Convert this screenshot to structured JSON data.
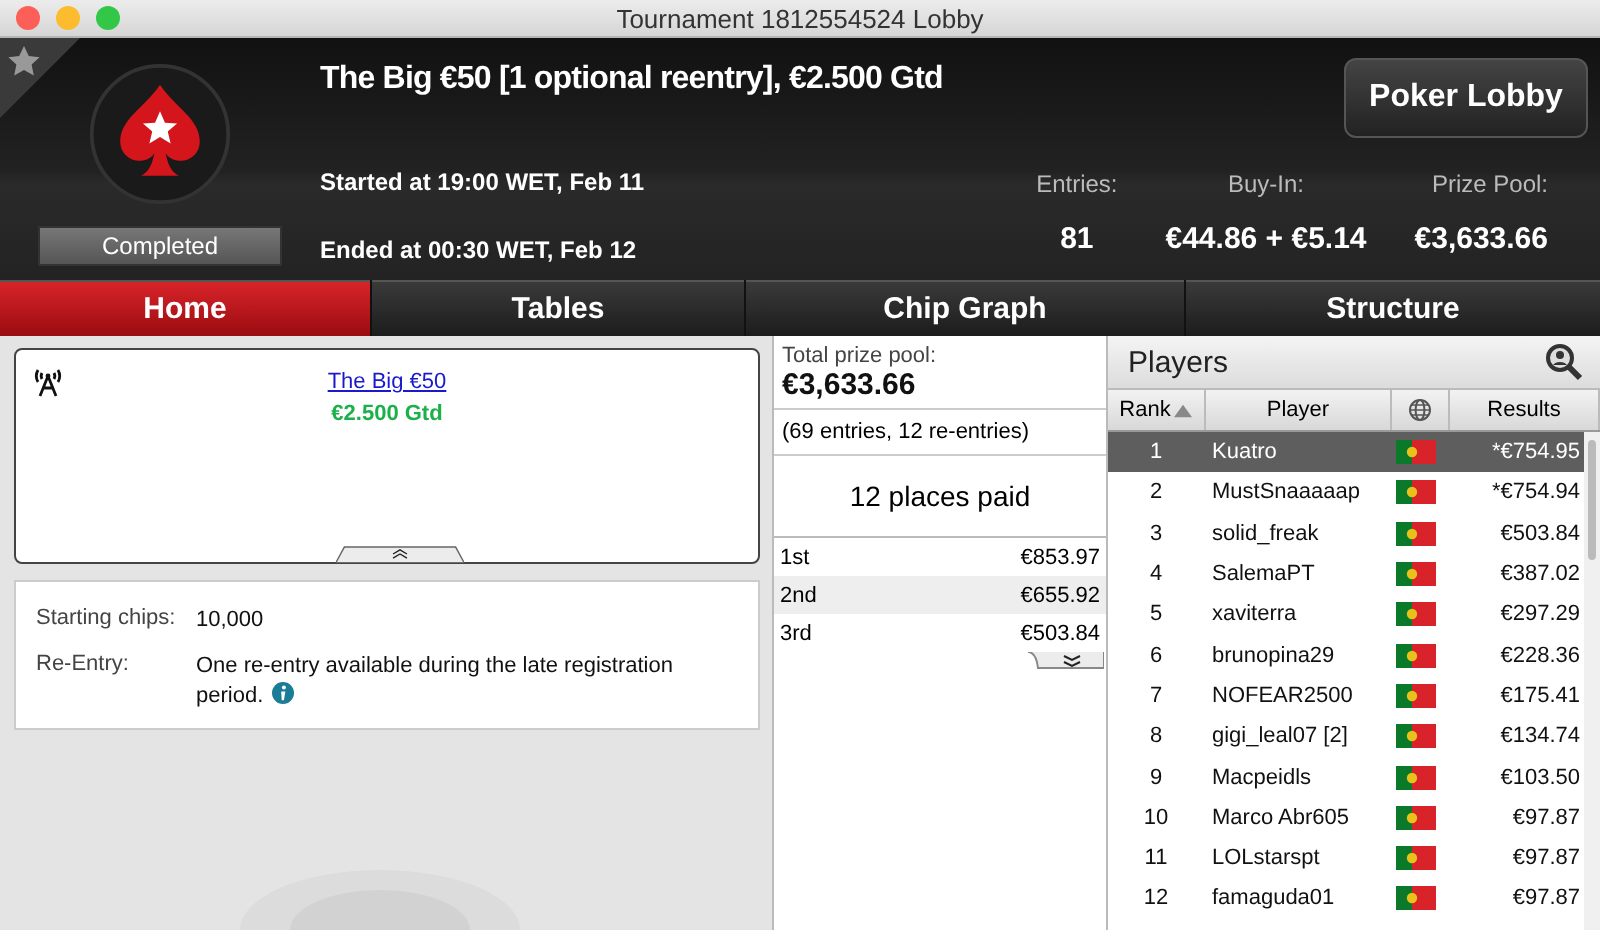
{
  "window": {
    "title": "Tournament 1812554524 Lobby"
  },
  "header": {
    "title": "The Big €50 [1 optional reentry], €2.500 Gtd",
    "status": "Completed",
    "started": "Started at 19:00 WET, Feb 11",
    "ended": "Ended at 00:30 WET, Feb 12",
    "lobby_button": "Poker Lobby",
    "stats": [
      {
        "label": "Entries:",
        "value": "81"
      },
      {
        "label": "Buy-In:",
        "value": "€44.86 + €5.14"
      },
      {
        "label": "Prize Pool:",
        "value": "€3,633.66"
      }
    ]
  },
  "tabs": [
    {
      "label": "Home",
      "selected": true
    },
    {
      "label": "Tables",
      "selected": false
    },
    {
      "label": "Chip Graph",
      "selected": false
    },
    {
      "label": "Structure",
      "selected": false
    }
  ],
  "info": {
    "link": "The Big €50",
    "guarantee": "€2.500 Gtd",
    "details": [
      {
        "label": "Starting chips:",
        "value": "10,000",
        "info": false
      },
      {
        "label": "Re-Entry:",
        "value": "One re-entry available during the late registration period.",
        "info": true
      }
    ]
  },
  "prizes": {
    "label": "Total prize pool:",
    "total": "€3,633.66",
    "entries": "(69 entries, 12 re-entries)",
    "places": "12 places paid",
    "rows": [
      {
        "place": "1st",
        "amount": "€853.97"
      },
      {
        "place": "2nd",
        "amount": "€655.92"
      },
      {
        "place": "3rd",
        "amount": "€503.84"
      }
    ]
  },
  "players": {
    "title": "Players",
    "columns": [
      "Rank",
      "Player",
      "Results"
    ],
    "rows": [
      {
        "rank": "1",
        "player": "Kuatro",
        "result": "*€754.95",
        "selected": true
      },
      {
        "rank": "2",
        "player": "MustSnaaaaap",
        "result": "*€754.94",
        "selected": false
      },
      {
        "rank": "3",
        "player": "solid_freak",
        "result": "€503.84",
        "selected": false
      },
      {
        "rank": "4",
        "player": "SalemaPT",
        "result": "€387.02",
        "selected": false
      },
      {
        "rank": "5",
        "player": "xaviterra",
        "result": "€297.29",
        "selected": false
      },
      {
        "rank": "6",
        "player": "brunopina29",
        "result": "€228.36",
        "selected": false
      },
      {
        "rank": "7",
        "player": "NOFEAR2500",
        "result": "€175.41",
        "selected": false
      },
      {
        "rank": "8",
        "player": "gigi_leal07 [2]",
        "result": "€134.74",
        "selected": false
      },
      {
        "rank": "9",
        "player": "Macpeidls",
        "result": "€103.50",
        "selected": false
      },
      {
        "rank": "10",
        "player": "Marco Abr605",
        "result": "€97.87",
        "selected": false
      },
      {
        "rank": "11",
        "player": "LOLstarspt",
        "result": "€97.87",
        "selected": false
      },
      {
        "rank": "12",
        "player": "famaguda01",
        "result": "€97.87",
        "selected": false
      }
    ]
  }
}
